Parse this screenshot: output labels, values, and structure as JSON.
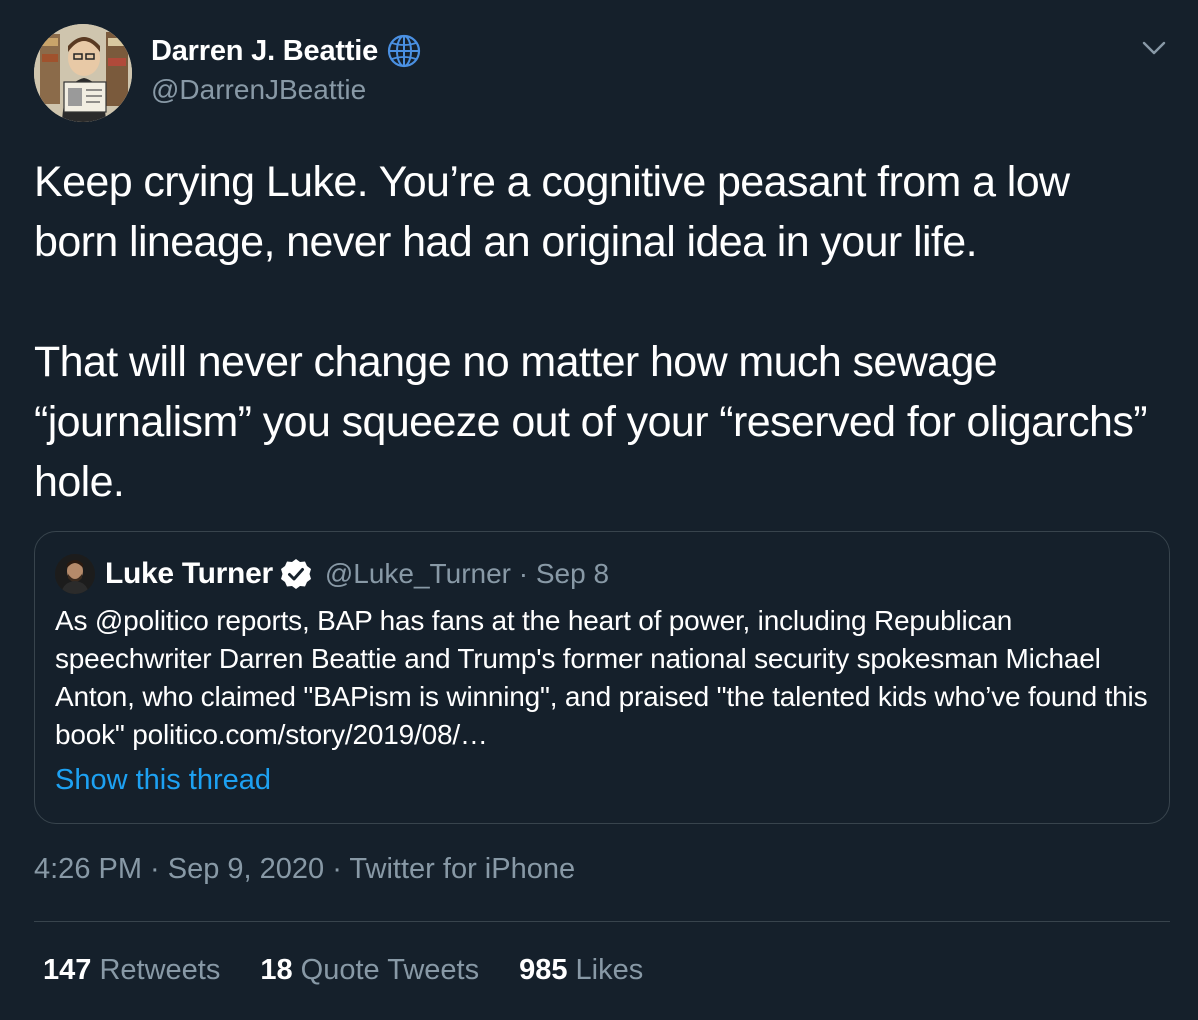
{
  "author": {
    "display_name": "Darren J. Beattie",
    "handle": "@DarrenJBeattie",
    "badge_icon": "globe-icon",
    "avatar": "caricature-avatar"
  },
  "tweet_body": {
    "paragraph_1": "Keep crying Luke. You’re a cognitive peasant from a low born lineage, never had an original idea in your life.",
    "paragraph_2": "That will never change no matter how much sewage “journalism” you squeeze out of your “reserved for oligarchs” hole."
  },
  "quoted_tweet": {
    "display_name": "Luke Turner",
    "verified_icon": "verified-badge-icon",
    "meta": "@Luke_Turner · Sep 8",
    "body": "As @politico reports, BAP has fans at the heart of power, including Republican speechwriter Darren Beattie and Trump's former national security spokesman Michael Anton, who claimed \"BAPism is winning\", and praised \"the talented kids who’ve found this book\" politico.com/story/2019/08/…",
    "show_thread": "Show this thread"
  },
  "timestamp": "4:26 PM · Sep 9, 2020 · Twitter for iPhone",
  "stats": {
    "retweets_count": "147",
    "retweets_label": "Retweets",
    "quotes_count": "18",
    "quotes_label": "Quote Tweets",
    "likes_count": "985",
    "likes_label": "Likes"
  },
  "colors": {
    "background": "#15202b",
    "secondary_text": "#8899a6",
    "accent": "#1da1f2",
    "border": "#38444d"
  }
}
